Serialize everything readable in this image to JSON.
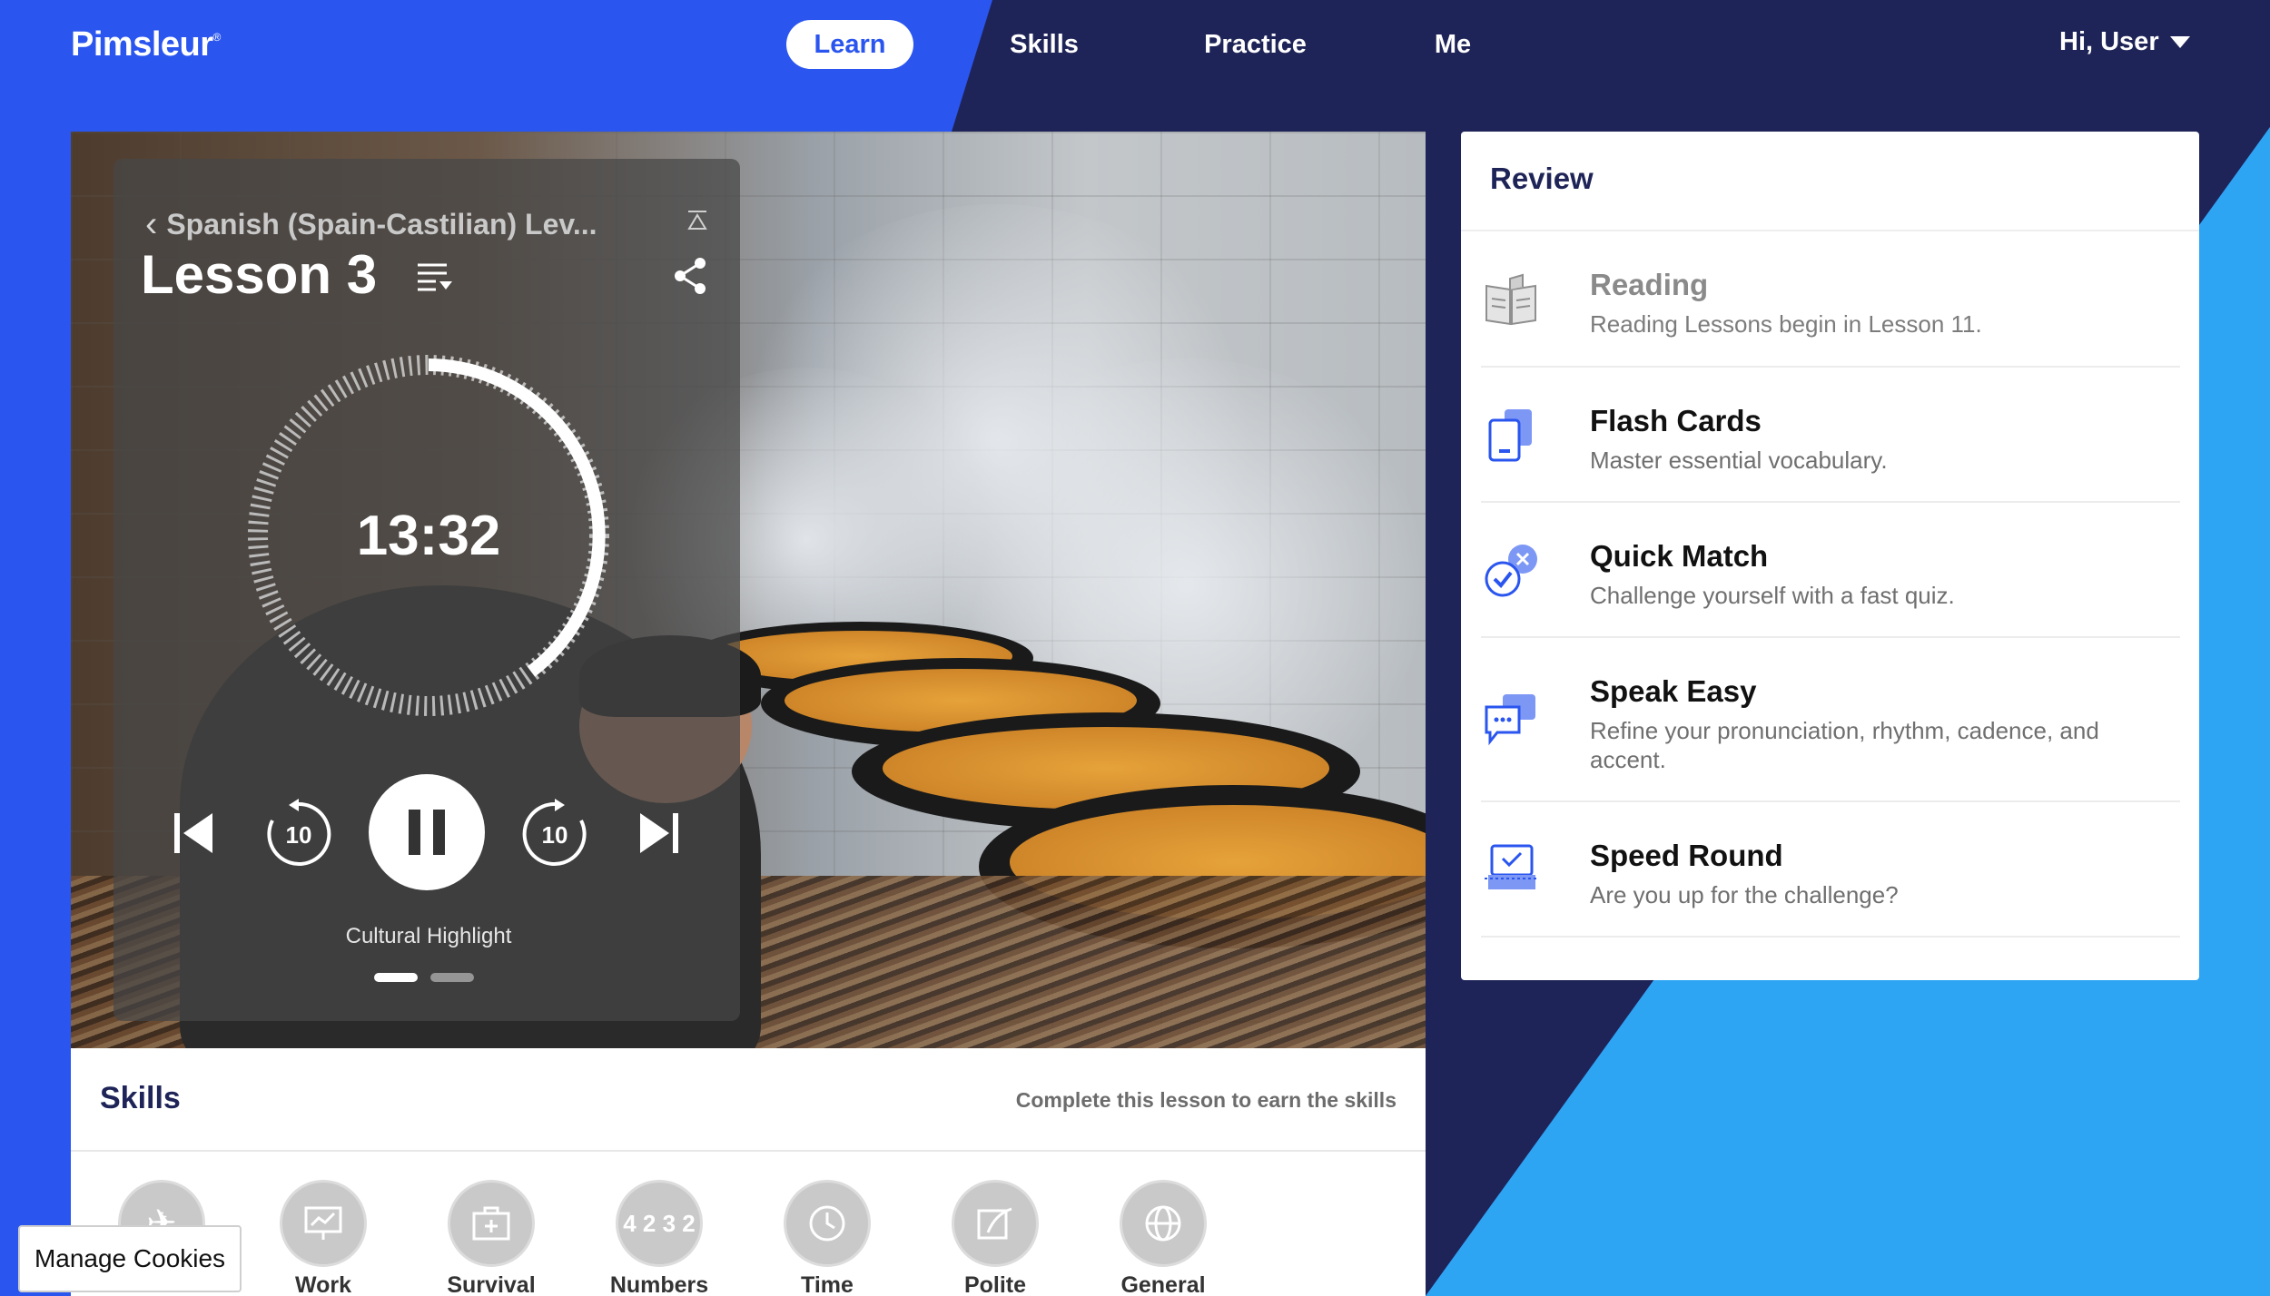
{
  "app": {
    "logo": "Pimsleur",
    "logo_mark": "®"
  },
  "nav": {
    "items": [
      {
        "label": "Learn",
        "active": true
      },
      {
        "label": "Skills"
      },
      {
        "label": "Practice"
      },
      {
        "label": "Me"
      }
    ],
    "user": "Hi, User"
  },
  "player": {
    "course": "Spanish (Spain-Castilian) Lev...",
    "lesson": "Lesson 3",
    "time": "13:32",
    "rewind_seconds": "10",
    "forward_seconds": "10",
    "caption": "Cultural Highlight",
    "slide_index": 1,
    "slide_count": 2
  },
  "review": {
    "title": "Review",
    "items": [
      {
        "title": "Reading",
        "desc": "Reading Lessons begin in Lesson 11.",
        "enabled": false,
        "icon": "book-icon"
      },
      {
        "title": "Flash Cards",
        "desc": "Master essential vocabulary.",
        "enabled": true,
        "icon": "flash-cards-icon"
      },
      {
        "title": "Quick Match",
        "desc": "Challenge yourself with a fast quiz.",
        "enabled": true,
        "icon": "quick-match-icon"
      },
      {
        "title": "Speak Easy",
        "desc": "Refine your pronunciation, rhythm, cadence, and accent.",
        "enabled": true,
        "icon": "speech-bubbles-icon"
      },
      {
        "title": "Speed Round",
        "desc": "Are you up for the challenge?",
        "enabled": true,
        "icon": "speed-round-icon"
      }
    ]
  },
  "skills": {
    "title": "Skills",
    "note": "Complete this lesson to earn the skills",
    "items": [
      {
        "label": "",
        "icon": "airplane-icon"
      },
      {
        "label": "Work",
        "icon": "presentation-icon"
      },
      {
        "label": "Survival",
        "icon": "first-aid-icon"
      },
      {
        "label": "Numbers",
        "icon": "numbers-icon",
        "glyph": "4 2 3 2"
      },
      {
        "label": "Time",
        "icon": "clock-icon"
      },
      {
        "label": "Polite",
        "icon": "letter-icon"
      },
      {
        "label": "General",
        "icon": "globe-icon"
      }
    ]
  },
  "cookies": {
    "label": "Manage Cookies"
  },
  "colors": {
    "brand_blue": "#2a55ef",
    "navy": "#1e2457",
    "light_blue": "#2ea5f3"
  }
}
